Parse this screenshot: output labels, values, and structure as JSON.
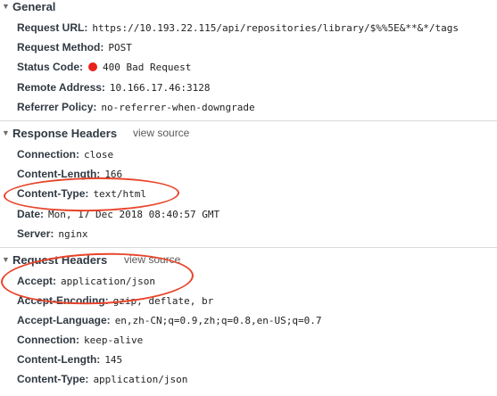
{
  "general": {
    "title": "General",
    "request_url_key": "Request URL:",
    "request_url": "https://10.193.22.115/api/repositories/library/$%%5E&**&*/tags",
    "request_method_key": "Request Method:",
    "request_method": "POST",
    "status_code_key": "Status Code:",
    "status_code": "400 Bad Request",
    "remote_address_key": "Remote Address:",
    "remote_address": "10.166.17.46:3128",
    "referrer_policy_key": "Referrer Policy:",
    "referrer_policy": "no-referrer-when-downgrade"
  },
  "response_headers": {
    "title": "Response Headers",
    "view_source": "view source",
    "connection_key": "Connection:",
    "connection": "close",
    "content_length_key": "Content-Length:",
    "content_length": "166",
    "content_type_key": "Content-Type:",
    "content_type": "text/html",
    "date_key": "Date:",
    "date": "Mon, 17 Dec 2018 08:40:57 GMT",
    "server_key": "Server:",
    "server": "nginx"
  },
  "request_headers": {
    "title": "Request Headers",
    "view_source": "view source",
    "accept_key": "Accept:",
    "accept": "application/json",
    "accept_encoding_key": "Accept-Encoding:",
    "accept_encoding": "gzip, deflate, br",
    "accept_language_key": "Accept-Language:",
    "accept_language": "en,zh-CN;q=0.9,zh;q=0.8,en-US;q=0.7",
    "connection_key": "Connection:",
    "connection": "keep-alive",
    "content_length_key": "Content-Length:",
    "content_length": "145",
    "content_type_key": "Content-Type:",
    "content_type": "application/json"
  },
  "icons": {
    "expanded": "triangle-down-icon",
    "status": "red-status-dot-icon"
  },
  "colors": {
    "status_error": "#e8221b",
    "annotation": "#e8442a"
  }
}
